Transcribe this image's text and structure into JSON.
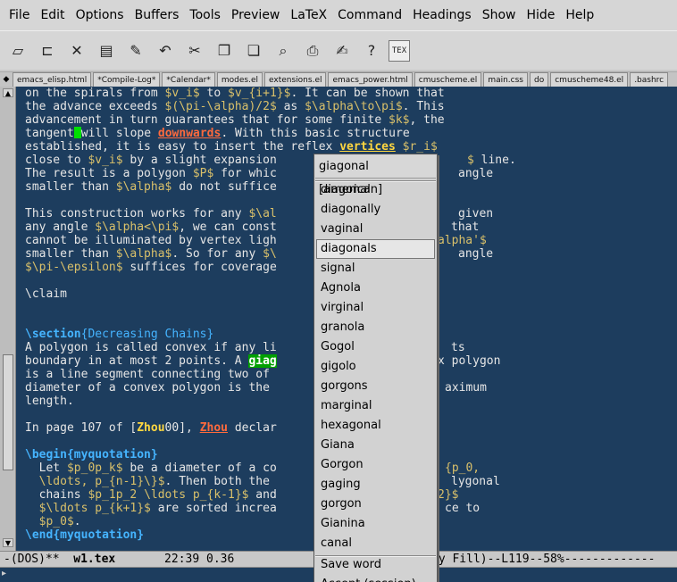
{
  "menubar": [
    "File",
    "Edit",
    "Options",
    "Buffers",
    "Tools",
    "Preview",
    "LaTeX",
    "Command",
    "Headings",
    "Show",
    "Hide",
    "Help"
  ],
  "toolbar": [
    {
      "name": "new-file-icon",
      "glyph": "▱"
    },
    {
      "name": "open-folder-icon",
      "glyph": "⊏"
    },
    {
      "name": "close-icon",
      "glyph": "✕"
    },
    {
      "name": "save-icon",
      "glyph": "▤"
    },
    {
      "name": "save-as-icon",
      "glyph": "✎"
    },
    {
      "name": "undo-icon",
      "glyph": "↶"
    },
    {
      "name": "cut-icon",
      "glyph": "✂"
    },
    {
      "name": "copy-icon",
      "glyph": "❐"
    },
    {
      "name": "paste-icon",
      "glyph": "❏"
    },
    {
      "name": "search-icon",
      "glyph": "⌕"
    },
    {
      "name": "print-icon",
      "glyph": "⎙"
    },
    {
      "name": "preferences-icon",
      "glyph": "✍"
    },
    {
      "name": "help-icon",
      "glyph": "?"
    }
  ],
  "tex_button": "TEX",
  "tabs": [
    "emacs_elisp.html",
    "*Compile-Log*",
    "*Calendar*",
    "modes.el",
    "extensions.el",
    "emacs_power.html",
    "cmuscheme.el",
    "main.css",
    "do",
    "cmuscheme48.el",
    ".bashrc"
  ],
  "editor_lines": {
    "l1": [
      "on the spirals from ",
      "$v_i$",
      " to ",
      "$v_{i+1}$",
      ". It can be shown that"
    ],
    "l2": [
      "the advance exceeds ",
      "$(\\pi-\\alpha)/2$",
      " as ",
      "$\\alpha\\to\\pi$",
      ". This"
    ],
    "l3": [
      "advancement in turn guarantees that for some finite ",
      "$k$",
      ", the"
    ],
    "l4": [
      "tangent",
      "will slope ",
      "downwards",
      ". With this basic structure"
    ],
    "l5": [
      "established, it is easy to insert the reflex ",
      "vertices",
      " ",
      "$r_i$"
    ],
    "l6": [
      "close to ",
      "$v_i$",
      " by a slight expansion",
      "$",
      " line."
    ],
    "l7": [
      "The result is a polygon ",
      "$P$",
      " for whic",
      "angle"
    ],
    "l8": [
      "smaller than ",
      "$\\alpha$",
      " do not suffice"
    ],
    "l9": [
      "This construction works for any ",
      "$\\al",
      "given"
    ],
    "l10": [
      "any angle ",
      "$\\alpha<\\pi$",
      ", we can const",
      "that"
    ],
    "l11": [
      "cannot be illuminated by vertex ligh",
      "alpha'$"
    ],
    "l12": [
      "smaller than ",
      "$\\alpha$",
      ". So for any ",
      "$\\",
      "angle"
    ],
    "l13": [
      "$\\pi-\\epsilon$",
      " suffices for coverage"
    ],
    "l14": [
      "\\claim"
    ],
    "l15": [
      "\\section",
      "{Decreasing Chains}"
    ],
    "l16": [
      "A polygon is called convex if any li",
      "ts"
    ],
    "l17": [
      "boundary in at most 2 points. A ",
      "giag",
      "x polygon"
    ],
    "l18": [
      "is a line segment connecting two of",
      "aximum"
    ],
    "l19": [
      "diameter of a convex polygon is the"
    ],
    "l20": [
      "length."
    ],
    "l21": [
      "In page 107 of [",
      "Zhou",
      "00], ",
      "Zhou",
      " declar"
    ],
    "l22": [
      "\\begin",
      "{myquotation}"
    ],
    "l23": [
      "  Let ",
      "$p_0p_k$",
      " be a diameter of a co",
      "{p_0,"
    ],
    "l24": [
      "  ",
      "\\ldots, p_{n-1}\\}$",
      ". Then both the",
      "lygonal"
    ],
    "l25": [
      "  chains ",
      "$p_1p_2 \\ldots p_{k-1}$",
      " and",
      "2}$"
    ],
    "l26": [
      "  ",
      "$\\ldots p_{k+1}$",
      " are sorted increa",
      "ce to"
    ],
    "l27": [
      "  ",
      "$p_0$",
      "."
    ],
    "l28": [
      "\\end",
      "{myquotation}"
    ]
  },
  "modeline": {
    "left": "-(DOS)**  ",
    "buffer": "w1.tex",
    "middle": "       22:39 0.36      ",
    "right": "ly Fill)--L119--58%-------------"
  },
  "popup": {
    "title": "giagonal [american]",
    "items": [
      "diagonal",
      "diagonally",
      "vaginal",
      "diagonals",
      "signal",
      "Agnola",
      "virginal",
      "granola",
      "Gogol",
      "gigolo",
      "gorgons",
      "marginal",
      "hexagonal",
      "Giana",
      "Gorgon",
      "gaging",
      "gorgon",
      "Gianina",
      "canal"
    ],
    "selected_index": 3,
    "actions": [
      "Save word",
      "Accept (session)"
    ]
  }
}
